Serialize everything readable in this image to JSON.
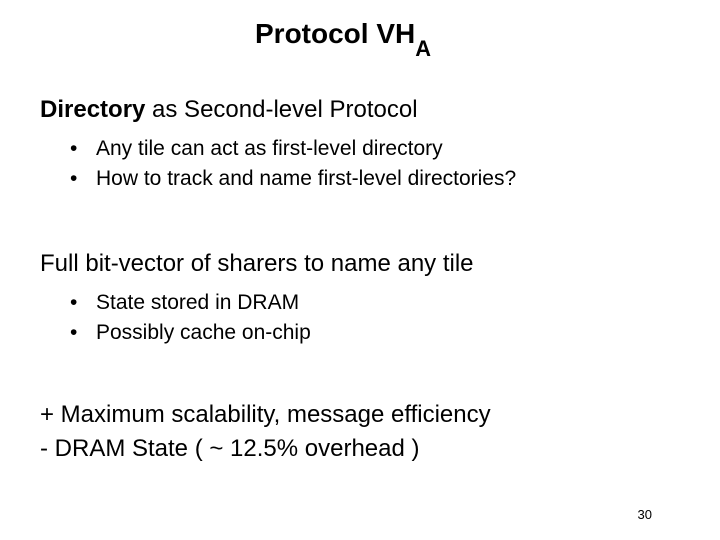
{
  "title": {
    "main": "Protocol VH",
    "subscript": "A"
  },
  "section1": {
    "bold": "Directory",
    "rest": " as Second-level Protocol",
    "bullets": [
      "Any tile can act as first-level directory",
      "How to track and name first-level directories?"
    ]
  },
  "section2": {
    "text": "Full bit-vector of sharers to name any tile",
    "bullets": [
      "State stored in DRAM",
      "Possibly cache on-chip"
    ]
  },
  "plus_minus": {
    "plus": "+ Maximum scalability, message efficiency",
    "minus": "-  DRAM State ( ~ 12.5% overhead )"
  },
  "page_number": "30"
}
